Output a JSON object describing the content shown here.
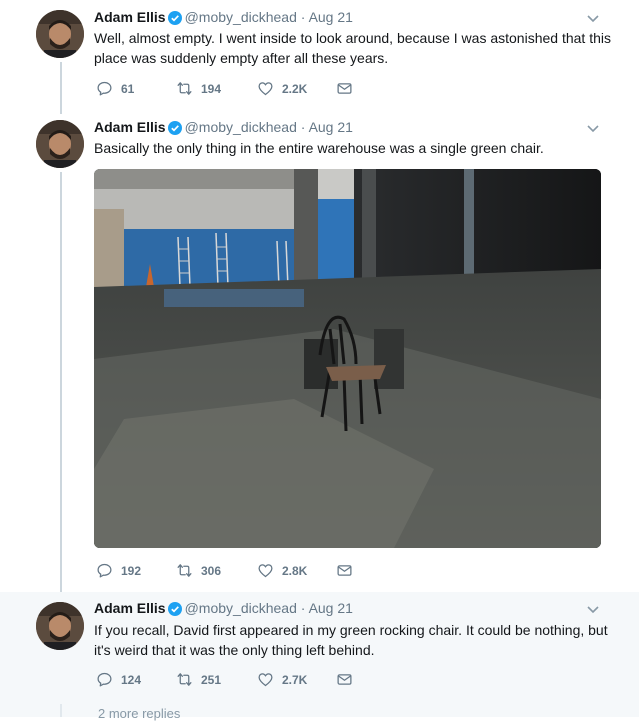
{
  "tweets": [
    {
      "name": "Adam Ellis",
      "handle": "@moby_dickhead",
      "date": "Aug 21",
      "text": "Well, almost empty. I went inside to look around, because I was astonished that this place was suddenly empty after all these years.",
      "replies": "61",
      "retweets": "194",
      "likes": "2.2K"
    },
    {
      "name": "Adam Ellis",
      "handle": "@moby_dickhead",
      "date": "Aug 21",
      "text": "Basically the only thing in the entire warehouse was a single green chair.",
      "replies": "192",
      "retweets": "306",
      "likes": "2.8K"
    },
    {
      "name": "Adam Ellis",
      "handle": "@moby_dickhead",
      "date": "Aug 21",
      "text": "If you recall, David first appeared in my green rocking chair. It could be nothing, but it's weird that it was the only thing left behind.",
      "replies": "124",
      "retweets": "251",
      "likes": "2.7K"
    }
  ],
  "separator": "·",
  "more_replies": "2 more replies",
  "colors": {
    "verified": "#1da1f2",
    "muted": "#657786",
    "highlight_bg": "#f5f8fa",
    "thread_line": "#ccd6dd"
  },
  "icons": [
    "reply-icon",
    "retweet-icon",
    "like-icon",
    "message-icon",
    "verified-badge-icon",
    "chevron-down-icon"
  ]
}
